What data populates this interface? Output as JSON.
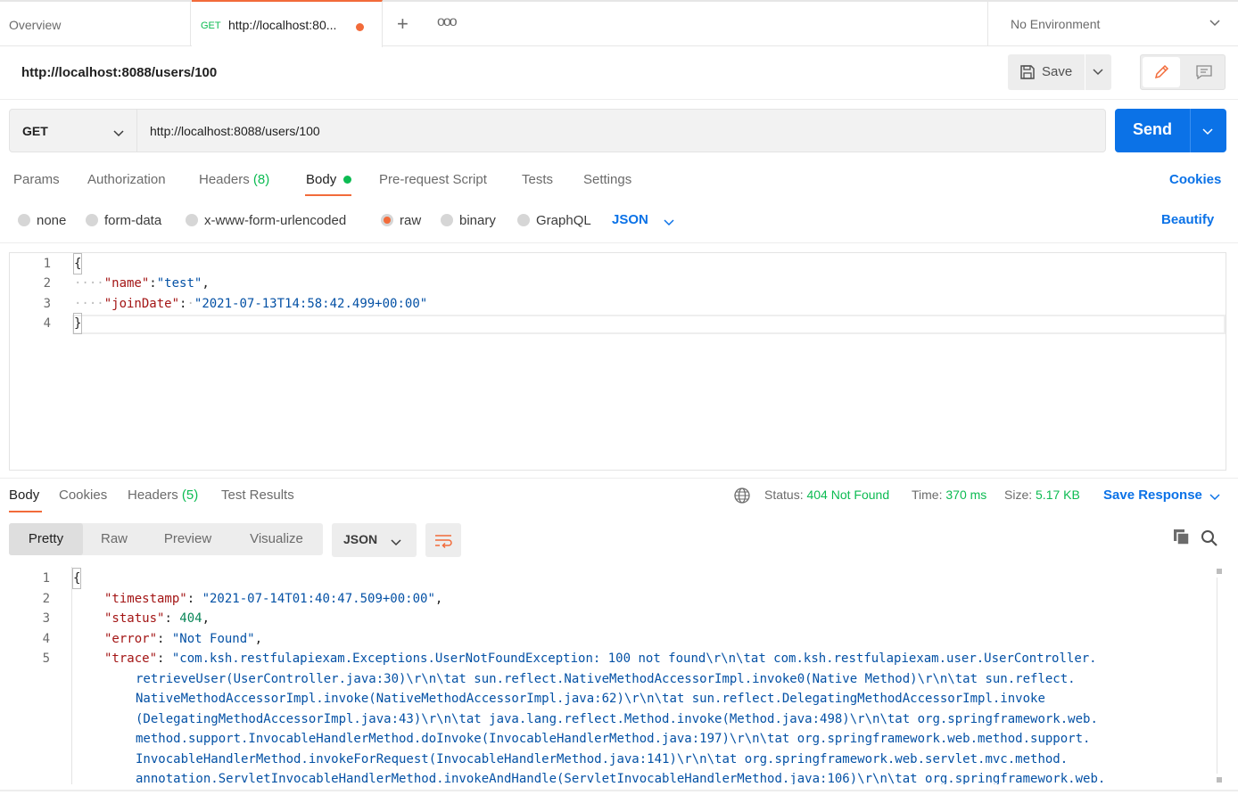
{
  "tabs": {
    "overview": "Overview",
    "active": {
      "method": "GET",
      "url": "http://localhost:80..."
    },
    "plus": "+",
    "more": "ooo"
  },
  "environment": "No Environment",
  "request": {
    "title": "http://localhost:8088/users/100",
    "save_label": "Save",
    "method": "GET",
    "url": "http://localhost:8088/users/100",
    "send_label": "Send",
    "tabs": {
      "params": "Params",
      "authorization": "Authorization",
      "headers": "Headers",
      "headers_count": "(8)",
      "body": "Body",
      "prerequest": "Pre-request Script",
      "tests": "Tests",
      "settings": "Settings"
    },
    "cookies": "Cookies",
    "body_types": [
      "none",
      "form-data",
      "x-www-form-urlencoded",
      "raw",
      "binary",
      "GraphQL"
    ],
    "body_format": "JSON",
    "beautify": "Beautify",
    "body_lines": [
      "1",
      "2",
      "3",
      "4"
    ],
    "body_code": {
      "open": "{",
      "name_key": "\"name\"",
      "name_val": "\"test\"",
      "join_key": "\"joinDate\"",
      "join_val": "\"2021-07-13T14:58:42.499+00:00\"",
      "close": "}"
    }
  },
  "response": {
    "tabs": {
      "body": "Body",
      "cookies": "Cookies",
      "headers": "Headers",
      "headers_count": "(5)",
      "test_results": "Test Results"
    },
    "status_label": "Status:",
    "status_value": "404 Not Found",
    "time_label": "Time:",
    "time_value": "370 ms",
    "size_label": "Size:",
    "size_value": "5.17 KB",
    "save_response": "Save Response",
    "views": [
      "Pretty",
      "Raw",
      "Preview",
      "Visualize"
    ],
    "format": "JSON",
    "lines": [
      "1",
      "2",
      "3",
      "4",
      "5"
    ],
    "code": {
      "open": "{",
      "timestamp_key": "\"timestamp\"",
      "timestamp_val": "\"2021-07-14T01:40:47.509+00:00\"",
      "status_key": "\"status\"",
      "status_val": "404",
      "error_key": "\"error\"",
      "error_val": "\"Not Found\"",
      "trace_key": "\"trace\"",
      "trace_lines": [
        "\"com.ksh.restfulapiexam.Exceptions.UserNotFoundException: 100 not found\\r\\n\\tat com.ksh.restfulapiexam.user.UserController.",
        "retrieveUser(UserController.java:30)\\r\\n\\tat sun.reflect.NativeMethodAccessorImpl.invoke0(Native Method)\\r\\n\\tat sun.reflect.",
        "NativeMethodAccessorImpl.invoke(NativeMethodAccessorImpl.java:62)\\r\\n\\tat sun.reflect.DelegatingMethodAccessorImpl.invoke",
        "(DelegatingMethodAccessorImpl.java:43)\\r\\n\\tat java.lang.reflect.Method.invoke(Method.java:498)\\r\\n\\tat org.springframework.web.",
        "method.support.InvocableHandlerMethod.doInvoke(InvocableHandlerMethod.java:197)\\r\\n\\tat org.springframework.web.method.support.",
        "InvocableHandlerMethod.invokeForRequest(InvocableHandlerMethod.java:141)\\r\\n\\tat org.springframework.web.servlet.mvc.method.",
        "annotation.ServletInvocableHandlerMethod.invokeAndHandle(ServletInvocableHandlerMethod.java:106)\\r\\n\\tat org.springframework.web."
      ]
    }
  },
  "colors": {
    "accent": "#f26b3a",
    "primary": "#0b72e7",
    "success": "#0cbb52"
  }
}
